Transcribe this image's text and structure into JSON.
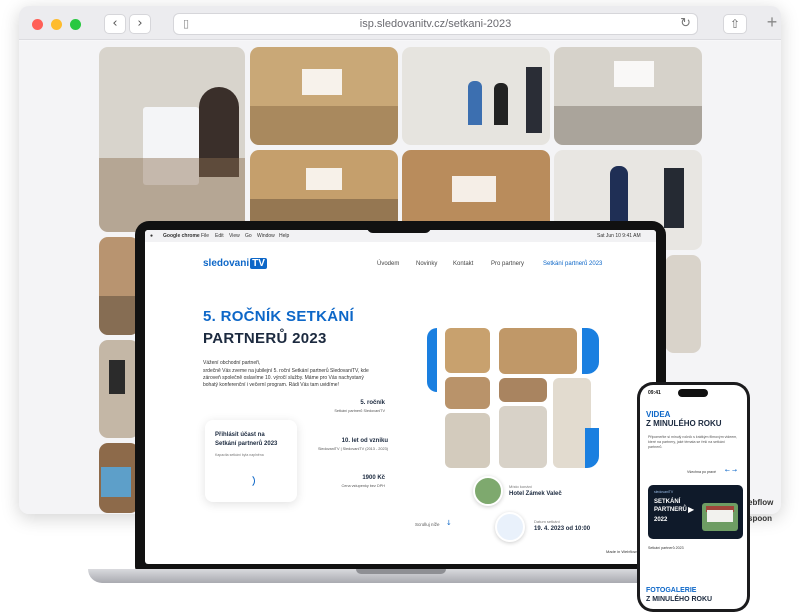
{
  "browser": {
    "url": "isp.sledovanitv.cz/setkani-2023",
    "back_icon": "chevron-left-icon",
    "forward_icon": "chevron-right-icon",
    "lock_icon": "lock-icon",
    "reload_icon": "reload-icon",
    "share_icon": "share-icon",
    "new_tab_icon": "plus-icon"
  },
  "mac_menu": {
    "app": "Google chrome",
    "items": [
      "File",
      "Edit",
      "View",
      "Go",
      "Window",
      "Help"
    ],
    "clock": "Sat Jun 10  9:41 AM"
  },
  "site": {
    "logo": "sledovani",
    "logo_badge": "TV",
    "nav": [
      "Úvodem",
      "Novinky",
      "Kontakt",
      "Pro partnery",
      "Setkání partnerů 2023"
    ],
    "active_nav_index": 4,
    "hero_title_line1": "5. ROČNÍK SETKÁNÍ",
    "hero_title_line2": "PARTNERŮ 2023",
    "intro_greeting": "Vážení obchodní partneři,",
    "intro_lines": [
      "srdečně Vás zveme na jubilejní 5. roční Setkání partnerů SledovaniTV, kde",
      "zároveň společně oslavíme 10. výročí služby. Máme pro Vás nachystaný",
      "bohatý konferenční i večerní program. Rádi Vás tam uvidíme!"
    ],
    "register_card": {
      "line1": "Přihlásit účast na",
      "line2": "Setkání partnerů 2023",
      "note": "Kapacita setkání byla naplněna"
    },
    "stats": [
      {
        "value": "5. ročník",
        "label": "Setkání partnerů SledovaniTV"
      },
      {
        "value": "10. let od vzniku",
        "label": "SledovaniTV | SledovaniTV (2013 - 2023)"
      },
      {
        "value": "1900 Kč",
        "label": "Cena vstupenky bez DPH"
      }
    ],
    "scroll_hint": "Scrolluj níže",
    "scroll_icon": "arrow-down-icon",
    "venue_label": "Místo konání",
    "venue_value": "Hotel Zámek Valeč",
    "date_label": "Datum setkání",
    "date_value": "19. 4. 2023 od 10:00",
    "made_in": "Made in Webflow",
    "edge_text": "ebflow",
    "edge_text_2": "spoon"
  },
  "phone": {
    "time": "09:41",
    "section1_title": "VIDEA",
    "section1_subtitle": "Z MINULÉHO ROKU",
    "section1_text": "Připomeňte si minulý ročník s krátkým filmovým videem, které na partnery, jaké témata se řeší na setkání partnerů.",
    "more_link": "Všechna po pravé",
    "arrows": "← →",
    "video_logo": "sledovaniTV",
    "video_title1": "SETKÁNÍ",
    "video_title2": "PARTNERŮ",
    "video_title3": "2022",
    "play_icon": "play-icon",
    "video_caption": "Setkání partnerů 2023",
    "section2_title": "FOTOGALERIE",
    "section2_subtitle": "Z MINULÉHO ROKU"
  },
  "colors": {
    "brand_blue": "#0d67c8",
    "accent_blue": "#1a7fe0",
    "dark_navy": "#1c2a3f",
    "traffic_red": "#ff5f57",
    "traffic_yellow": "#febc2e",
    "traffic_green": "#28c840"
  }
}
